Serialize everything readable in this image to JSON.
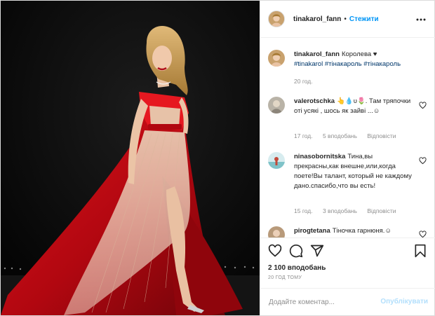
{
  "post": {
    "photo_alt": "",
    "header": {
      "username": "tinakarol_fann",
      "separator": "•",
      "follow_label": "Стежити"
    },
    "caption": {
      "username": "tinakarol_fann",
      "text": "Королева ♥",
      "tags": "#tinakarol #тінакароль #тінакароль",
      "time": "20 год."
    },
    "comments": [
      {
        "username": "valerotschka",
        "text": "👆💧υ🌷. Там тряпочки оті усякі , шось як зайві ...☺",
        "time": "17 год.",
        "likes": "5 вподобань",
        "reply": "Відповісти"
      },
      {
        "username": "ninasobornitska",
        "text": "Тина,вы прекрасны,как внешне,или,когда поете!Вы талант, который не каждому дано.спасибо,что вы есть!",
        "time": "15 год.",
        "likes": "3 вподобань",
        "reply": "Відповісти"
      },
      {
        "username": "pirogtetana",
        "text": "Тіночка гарнюня.☺",
        "time": "",
        "likes": "",
        "reply": ""
      }
    ],
    "likes_count": "2 100 вподобань",
    "timestamp": "20 ГОД ТОМУ",
    "add_comment": {
      "placeholder": "Додайте коментар...",
      "publish_label": "Опублікувати"
    },
    "icons": {
      "like": "heart-icon",
      "comment": "comment-icon",
      "share": "share-icon",
      "save": "bookmark-icon",
      "more": "more-icon"
    }
  }
}
